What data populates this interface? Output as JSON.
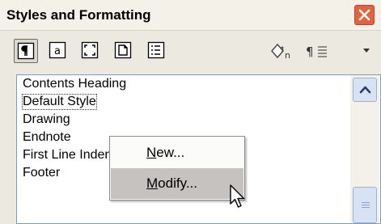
{
  "panel": {
    "title": "Styles and Formatting"
  },
  "toolbar": {
    "buttons": [
      {
        "icon": "paragraph-styles-icon",
        "pressed": true
      },
      {
        "icon": "character-styles-icon",
        "pressed": false
      },
      {
        "icon": "frame-styles-icon",
        "pressed": false
      },
      {
        "icon": "page-styles-icon",
        "pressed": false
      },
      {
        "icon": "list-styles-icon",
        "pressed": false
      }
    ],
    "fill_format_icon": "fill-format-mode-icon",
    "new_style_icon": "new-style-from-selection-icon",
    "dropdown_icon": "chevron-down-icon"
  },
  "style_list": {
    "items": [
      {
        "label": "Contents Heading"
      },
      {
        "label": "Default Style",
        "selected": true
      },
      {
        "label": "Drawing"
      },
      {
        "label": "Endnote"
      },
      {
        "label": "First Line Indent"
      },
      {
        "label": "Footer"
      }
    ]
  },
  "context_menu": {
    "new": {
      "mnemonic": "N",
      "rest": "ew..."
    },
    "modify": {
      "mnemonic": "M",
      "rest": "odify...",
      "hovered": true
    }
  },
  "colors": {
    "close_button": "#e0643f",
    "scrollbar": "#d8e2f5",
    "menu_highlight": "#c5c2bf"
  }
}
